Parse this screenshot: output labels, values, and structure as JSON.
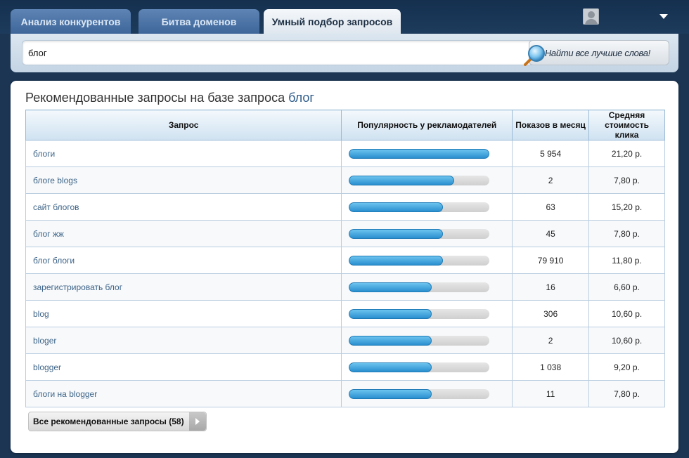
{
  "tabs": [
    {
      "label": "Анализ конкурентов",
      "active": false
    },
    {
      "label": "Битва доменов",
      "active": false
    },
    {
      "label": "Умный подбор запросов",
      "active": true
    }
  ],
  "search": {
    "value": "блог",
    "button_label": "Найти все лучшие слова!"
  },
  "main": {
    "title_prefix": "Рекомендованные запросы на базе запроса",
    "title_query": "блог",
    "columns": {
      "query": "Запрос",
      "popularity": "Популярность у рекламодателей",
      "impressions": "Показов в месяц",
      "cpc": "Средняя стоимость клика"
    },
    "rows": [
      {
        "query": "блоги",
        "popularity": 1.0,
        "impressions": "5 954",
        "cpc": "21,20 р."
      },
      {
        "query": "блоге blogs",
        "popularity": 0.75,
        "impressions": "2",
        "cpc": "7,80 р."
      },
      {
        "query": "сайт блогов",
        "popularity": 0.67,
        "impressions": "63",
        "cpc": "15,20 р."
      },
      {
        "query": "блог жж",
        "popularity": 0.67,
        "impressions": "45",
        "cpc": "7,80 р."
      },
      {
        "query": "блог блоги",
        "popularity": 0.67,
        "impressions": "79 910",
        "cpc": "11,80 р."
      },
      {
        "query": "зарегистрировать блог",
        "popularity": 0.59,
        "impressions": "16",
        "cpc": "6,60 р."
      },
      {
        "query": "blog",
        "popularity": 0.59,
        "impressions": "306",
        "cpc": "10,60 р."
      },
      {
        "query": "bloger",
        "popularity": 0.59,
        "impressions": "2",
        "cpc": "10,60 р."
      },
      {
        "query": "blogger",
        "popularity": 0.59,
        "impressions": "1 038",
        "cpc": "9,20 р."
      },
      {
        "query": "блоги на blogger",
        "popularity": 0.59,
        "impressions": "11",
        "cpc": "7,80 р."
      }
    ],
    "all_button_label": "Все рекомендованные запросы (58)"
  },
  "icons": {
    "user": "user-avatar-icon",
    "menu": "dropdown-arrow-icon",
    "search": "magnifier-icon",
    "next": "arrow-right-icon"
  }
}
